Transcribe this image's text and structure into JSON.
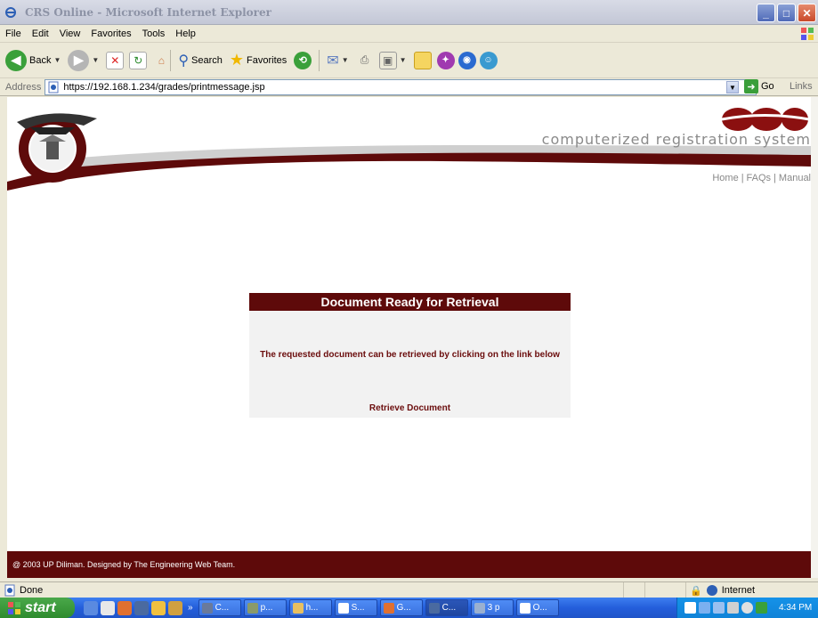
{
  "window": {
    "title": "CRS Online - Microsoft Internet Explorer"
  },
  "menubar": {
    "items": [
      "File",
      "Edit",
      "View",
      "Favorites",
      "Tools",
      "Help"
    ]
  },
  "toolbar": {
    "back_label": "Back",
    "search_label": "Search",
    "favorites_label": "Favorites"
  },
  "address": {
    "label": "Address",
    "url": "https://192.168.1.234/grades/printmessage.jsp",
    "go_label": "Go",
    "links_label": "Links"
  },
  "header": {
    "tagline": "computerized registration system"
  },
  "nav": {
    "home": "Home",
    "faqs": "FAQs",
    "manual": "Manual",
    "separator": "|"
  },
  "panel": {
    "title": "Document Ready for Retrieval",
    "message": "The requested document can be retrieved by clicking on the link below",
    "link": "Retrieve Document"
  },
  "footer": {
    "text": "@ 2003 UP Diliman. Designed by The Engineering Web Team."
  },
  "status": {
    "text": "Done",
    "zone": "Internet"
  },
  "taskbar": {
    "start_label": "start",
    "chevron": "»",
    "tasks": [
      {
        "label": "C...",
        "icon": "#6a7a9a"
      },
      {
        "label": "p...",
        "icon": "#8a9a6a"
      },
      {
        "label": "h...",
        "icon": "#e8c060"
      },
      {
        "label": "S...",
        "icon": "#ffffff"
      },
      {
        "label": "G...",
        "icon": "#e07030"
      },
      {
        "label": "C...",
        "icon": "#4a6aa0"
      },
      {
        "label": "3 p",
        "icon": "#9ab0d0"
      },
      {
        "label": "O...",
        "icon": "#ffffff"
      }
    ],
    "clock": "4:34 PM"
  },
  "colors": {
    "maroon": "#5e0a0a",
    "text_maroon": "#6b0d0d",
    "taskbar_blue": "#245edb"
  }
}
